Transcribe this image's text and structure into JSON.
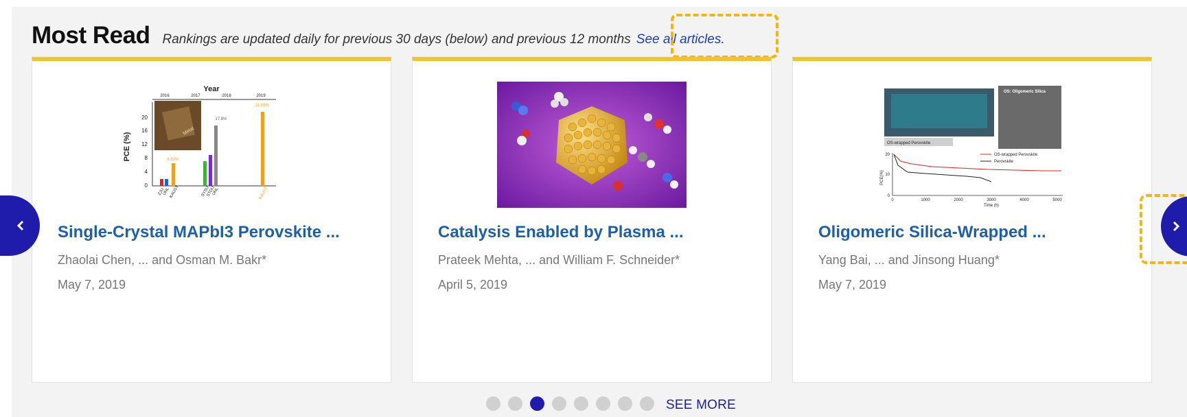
{
  "header": {
    "title": "Most Read",
    "subtitle": "Rankings are updated daily for previous 30 days (below) and previous 12 months",
    "see_all_label": "See all articles."
  },
  "cards": [
    {
      "title": "Single-Crystal MAPbI3 Perovskite ...",
      "authors": "Zhaolai Chen, ... and Osman M. Bakr*",
      "date": "May 7, 2019",
      "figure": {
        "top_axis_title": "Year",
        "years": [
          "2016",
          "2017",
          "2018",
          "2019"
        ],
        "ylabel": "PCE (%)",
        "yticks": [
          "20",
          "16",
          "12",
          "8",
          "4",
          "0"
        ],
        "labels": [
          "21.09%",
          "17.8%",
          "6.53%"
        ],
        "xlabels": [
          "ZJU",
          "UNL",
          "KAUST",
          "SYSU",
          "STDU",
          "UNL",
          "KAUST"
        ],
        "inset_text": "Metal"
      }
    },
    {
      "title": "Catalysis Enabled by Plasma ...",
      "authors": "Prateek Mehta, ... and William F. Schneider*",
      "date": "April 5, 2019"
    },
    {
      "title": "Oligomeric Silica-Wrapped ...",
      "authors": "Yang Bai, ... and Jinsong Huang*",
      "date": "May 7, 2019",
      "figure": {
        "inset_title": "OS: Oligomeric Silica",
        "panel_label": "OS-wrapped Perovskite",
        "legend": [
          "OS-wrapped Perovskite",
          "Perovskite"
        ],
        "ylabel": "PCE(%)",
        "xlabel": "Time (h)",
        "xticks": [
          "0",
          "1000",
          "2000",
          "3000",
          "4000",
          "5000"
        ],
        "yticks": [
          "20",
          "10",
          "0"
        ]
      }
    }
  ],
  "carousel": {
    "dot_count": 8,
    "active_index": 2,
    "see_more_label": "SEE MORE"
  },
  "colors": {
    "accent": "#1f1cab",
    "card_top_border": "#f3c230",
    "title_link": "#1d5fa8",
    "highlight": "#f5b50f"
  },
  "icons": {
    "prev": "chevron-left-icon",
    "next": "chevron-right-icon"
  }
}
